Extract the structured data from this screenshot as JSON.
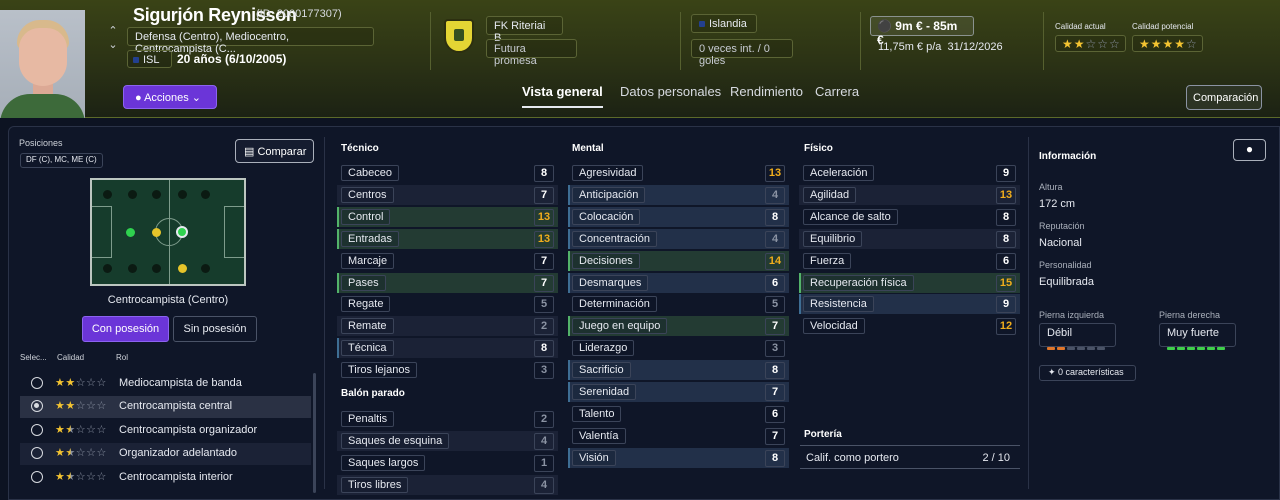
{
  "header": {
    "name": "Sigurjón Reynisson",
    "id": "(ID: 2000177307)",
    "positions": "Defensa (Centro), Mediocentro, Centrocampista (C...",
    "nationality_code": "ISL",
    "age": "20 años (6/10/2005)",
    "actions_label": "Acciones",
    "club": "FK Riteriai B",
    "status": "Futura promesa",
    "country": "Islandia",
    "caps": "0 veces int. / 0 goles",
    "value": "9m € - 85m €",
    "wage": "11,75m € p/a",
    "contract_end": "31/12/2026",
    "current_quality_label": "Calidad actual",
    "current_quality_stars": 2,
    "potential_quality_label": "Calidad potencial",
    "potential_quality_stars": 3.5
  },
  "tabs": [
    "Vista general",
    "Datos personales",
    "Rendimiento",
    "Carrera"
  ],
  "compare_top": "Comparación",
  "left": {
    "positions_label": "Posiciones",
    "positions_value": "DF (C), MC, ME (C)",
    "compare_label": "Comparar",
    "pitch_label": "Centrocampista (Centro)",
    "toggle_on": "Con posesión",
    "toggle_off": "Sin posesión",
    "cols": [
      "Selec...",
      "Calidad",
      "Rol"
    ],
    "roles": [
      {
        "name": "Mediocampista de banda",
        "stars": 2,
        "selected": false
      },
      {
        "name": "Centrocampista central",
        "stars": 2,
        "selected": true
      },
      {
        "name": "Centrocampista organizador",
        "stars": 1.5,
        "selected": false
      },
      {
        "name": "Organizador adelantado",
        "stars": 1.5,
        "selected": false
      },
      {
        "name": "Centrocampista interior",
        "stars": 1.5,
        "selected": false
      }
    ]
  },
  "tecnico": {
    "title": "Técnico",
    "attrs": [
      {
        "name": "Cabeceo",
        "value": "8"
      },
      {
        "name": "Centros",
        "value": "7"
      },
      {
        "name": "Control",
        "value": "13"
      },
      {
        "name": "Entradas",
        "value": "13"
      },
      {
        "name": "Marcaje",
        "value": "7"
      },
      {
        "name": "Pases",
        "value": "7"
      },
      {
        "name": "Regate",
        "value": "5"
      },
      {
        "name": "Remate",
        "value": "2"
      },
      {
        "name": "Técnica",
        "value": "8"
      },
      {
        "name": "Tiros lejanos",
        "value": "3"
      }
    ]
  },
  "balon": {
    "title": "Balón parado",
    "attrs": [
      {
        "name": "Penaltis",
        "value": "2"
      },
      {
        "name": "Saques de esquina",
        "value": "4"
      },
      {
        "name": "Saques largos",
        "value": "1"
      },
      {
        "name": "Tiros libres",
        "value": "4"
      }
    ]
  },
  "mental": {
    "title": "Mental",
    "attrs": [
      {
        "name": "Agresividad",
        "value": "13"
      },
      {
        "name": "Anticipación",
        "value": "4"
      },
      {
        "name": "Colocación",
        "value": "8"
      },
      {
        "name": "Concentración",
        "value": "4"
      },
      {
        "name": "Decisiones",
        "value": "14"
      },
      {
        "name": "Desmarques",
        "value": "6"
      },
      {
        "name": "Determinación",
        "value": "5"
      },
      {
        "name": "Juego en equipo",
        "value": "7"
      },
      {
        "name": "Liderazgo",
        "value": "3"
      },
      {
        "name": "Sacrificio",
        "value": "8"
      },
      {
        "name": "Serenidad",
        "value": "7"
      },
      {
        "name": "Talento",
        "value": "6"
      },
      {
        "name": "Valentía",
        "value": "7"
      },
      {
        "name": "Visión",
        "value": "8"
      }
    ]
  },
  "fisico": {
    "title": "Físico",
    "attrs": [
      {
        "name": "Aceleración",
        "value": "9"
      },
      {
        "name": "Agilidad",
        "value": "13"
      },
      {
        "name": "Alcance de salto",
        "value": "8"
      },
      {
        "name": "Equilibrio",
        "value": "8"
      },
      {
        "name": "Fuerza",
        "value": "6"
      },
      {
        "name": "Recuperación física",
        "value": "15"
      },
      {
        "name": "Resistencia",
        "value": "9"
      },
      {
        "name": "Velocidad",
        "value": "12"
      }
    ]
  },
  "porteria": {
    "title": "Portería",
    "label": "Calif. como portero",
    "value": "2 / 10"
  },
  "info": {
    "title": "Información",
    "height_label": "Altura",
    "height": "172 cm",
    "reputation_label": "Reputación",
    "reputation": "Nacional",
    "personality_label": "Personalidad",
    "personality": "Equilibrada",
    "left_foot_label": "Pierna izquierda",
    "left_foot": "Débil",
    "left_foot_level": 2,
    "right_foot_label": "Pierna derecha",
    "right_foot": "Muy fuerte",
    "right_foot_level": 6,
    "traits": "0 características"
  },
  "colors": {
    "accent": "#6b35d8",
    "orange": "#f0ad1c",
    "green": "#2fd24f",
    "yellow_star": "#f4c431"
  }
}
